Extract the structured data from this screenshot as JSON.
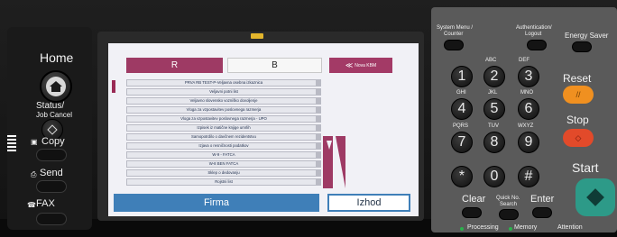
{
  "left_panel": {
    "home": "Home",
    "status": "Status/",
    "job_cancel": "Job Cancel",
    "copy": "Copy",
    "send": "Send",
    "fax": "FAX"
  },
  "screen": {
    "tab_r": "R",
    "tab_b": "B",
    "logo": "Nova KBM",
    "items": [
      "PRVA RB TEST-P-Veljavna osebna izkaznica",
      "Veljavni potni list",
      "Veljavno slovensko vozniško dovoljenje",
      "Vloga za vzpostavitev poslovnega razmerja",
      "Vloga za vzpostavitev poslovnega razmerja - UPO",
      "Izpisek iz matične knjige umrlih",
      "Samopotrdilo o davčnem rezidentstvu",
      "Izjava o resničnosti podatkov",
      "W-9 - FATCA",
      "W-8 BEN FATCA",
      "Sklep o dedovanju",
      "Rojstni list"
    ],
    "firma_label": "Firma",
    "izhod_label": "Izhod"
  },
  "keypad": {
    "system_menu": "System Menu /",
    "counter": "Counter",
    "authentication": "Authentication/",
    "logout": "Logout",
    "energy_saver": "Energy Saver",
    "reset": "Reset",
    "stop": "Stop",
    "start": "Start",
    "clear": "Clear",
    "quick_no": "Quick No.",
    "search": "Search",
    "enter": "Enter",
    "processing": "Processing",
    "memory": "Memory",
    "attention": "Attention",
    "keys": [
      {
        "num": "1",
        "sub": ""
      },
      {
        "num": "2",
        "sub": "ABC"
      },
      {
        "num": "3",
        "sub": "DEF"
      },
      {
        "num": "4",
        "sub": "GHI"
      },
      {
        "num": "5",
        "sub": "JKL"
      },
      {
        "num": "6",
        "sub": "MNO"
      },
      {
        "num": "7",
        "sub": "PQRS"
      },
      {
        "num": "8",
        "sub": "TUV"
      },
      {
        "num": "9",
        "sub": "WXYZ"
      },
      {
        "num": "*",
        "sub": ""
      },
      {
        "num": "0",
        "sub": ""
      },
      {
        "num": "#",
        "sub": ""
      }
    ]
  },
  "colors": {
    "tab_active": "#9e3a64",
    "button_blue": "#3f7fb8",
    "reset": "#f09020",
    "stop": "#e24a2a",
    "start": "#2d9a88"
  }
}
